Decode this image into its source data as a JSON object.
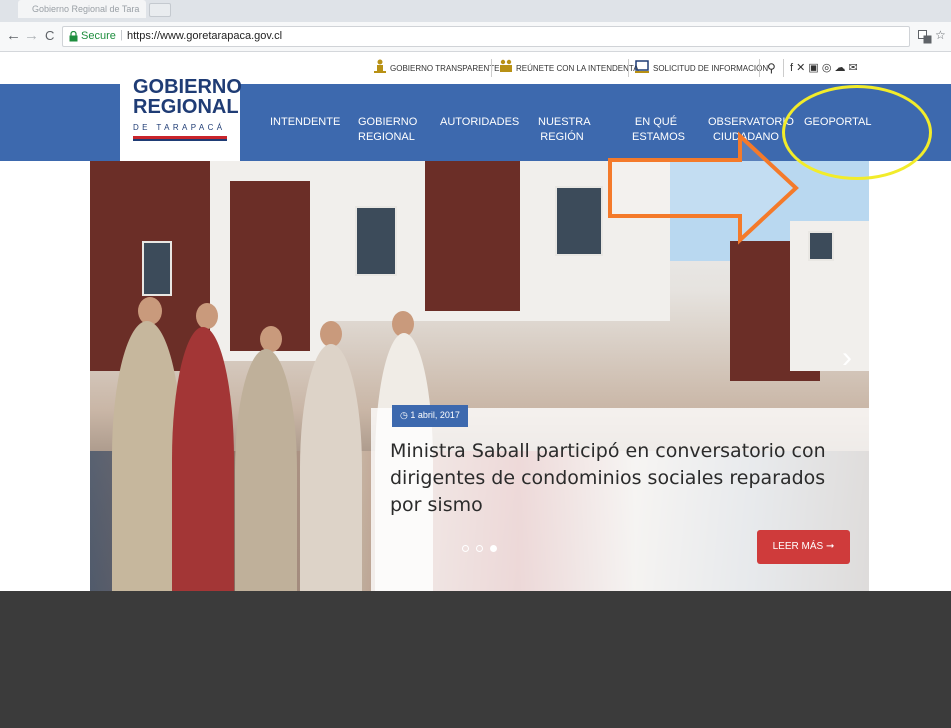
{
  "browser": {
    "tab_title": "Gobierno Regional de Tara",
    "tab_close": "×",
    "back": "←",
    "forward": "→",
    "reload": "C",
    "lock_icon": "lock-icon",
    "secure_label": "Secure",
    "url": "https://www.goretarapaca.gov.cl",
    "translate_icon": "translate-icon",
    "star": "☆"
  },
  "util_bar": {
    "items": [
      "GOBIERNO TRANSPARENTE",
      "REÚNETE CON LA INTENDENTA",
      "SOLICITUD DE INFORMACIÓN"
    ],
    "search_icon": "⚲",
    "social": "f ✕ ▣ ◎ ☁ ✉"
  },
  "logo": {
    "line1": "GOBIERNO",
    "line2": "REGIONAL",
    "line3": "DE TARAPACÁ"
  },
  "nav": {
    "items": [
      {
        "label": "INTENDENTE"
      },
      {
        "label": "GOBIERNO REGIONAL"
      },
      {
        "label": "AUTORIDADES"
      },
      {
        "label": "NUESTRA REGIÓN"
      },
      {
        "label": "EN QUÉ ESTAMOS"
      },
      {
        "label": "OBSERVATORIO CIUDADANO"
      },
      {
        "label": "GEOPORTAL"
      }
    ]
  },
  "hero": {
    "date": "◷ 1 abril, 2017",
    "headline": "Ministra Saball participó en conversatorio con dirigentes de condominios sociales reparados por sismo",
    "cta": "LEER MÁS ➞",
    "next": "›"
  },
  "colors": {
    "brand_blue": "#3d69ae",
    "logo_navy": "#1f3c75",
    "cta_red": "#cf3b3b",
    "annotation_orange": "#f47a2a",
    "annotation_yellow": "#f2ec2a"
  }
}
